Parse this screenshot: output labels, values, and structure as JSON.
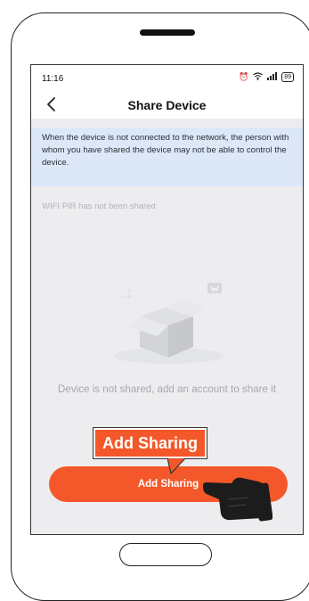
{
  "status_bar": {
    "time": "11:16",
    "battery": "89"
  },
  "header": {
    "title": "Share Device"
  },
  "notice": {
    "text": "When the device is not connected to the network, the person with whom you have shared the device may not be able to control the device."
  },
  "share_status": "WIFI PIR has not been shared",
  "empty_state": {
    "text": "Device is not shared, add an account to share it"
  },
  "add_button": {
    "label": "Add Sharing"
  },
  "callout": {
    "label": "Add Sharing"
  },
  "colors": {
    "accent": "#f4582a",
    "notice_bg": "#dce8f8",
    "screen_bg": "#ededef"
  }
}
